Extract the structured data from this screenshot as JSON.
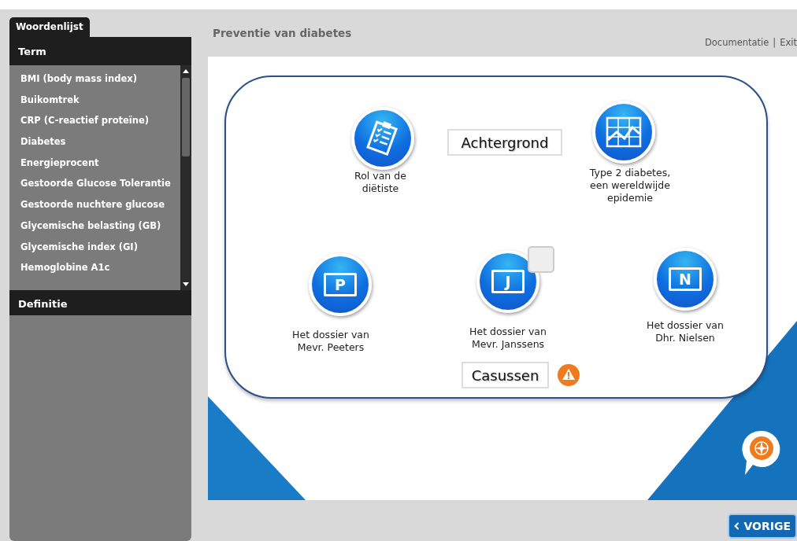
{
  "sidebar": {
    "tab": "Woordenlijst",
    "term_header": "Term",
    "terms": [
      {
        "label": "BMI (body mass index)",
        "selected": false
      },
      {
        "label": "Buikomtrek",
        "selected": false
      },
      {
        "label": "CRP (C-reactief proteïne)",
        "selected": false
      },
      {
        "label": "Diabetes",
        "selected": false
      },
      {
        "label": "Energieprocent",
        "selected": false
      },
      {
        "label": "Gestoorde Glucose Tolerantie",
        "selected": false
      },
      {
        "label": "Gestoorde nuchtere glucose",
        "selected": false
      },
      {
        "label": "Glycemische belasting (GB)",
        "selected": false
      },
      {
        "label": "Glycemische index (GI)",
        "selected": false
      },
      {
        "label": "Hemoglobine A1c",
        "selected": false
      }
    ],
    "definition_header": "Definitie"
  },
  "header": {
    "title": "Preventie van diabetes",
    "links": [
      "Documentatie",
      "Exit"
    ],
    "separator": "|"
  },
  "stage": {
    "sections": [
      {
        "label": "Achtergrond",
        "warning": false
      },
      {
        "label": "Casussen",
        "warning": true
      }
    ],
    "topics": [
      {
        "kind": "clipboard",
        "label": "Rol van de diëtiste"
      },
      {
        "kind": "chart",
        "label": "Type 2 diabetes, een wereldwijde epidemie"
      },
      {
        "kind": "folder",
        "letter": "P",
        "label": "Het dossier van Mevr. Peeters"
      },
      {
        "kind": "folder",
        "letter": "J",
        "label": "Het dossier van Mevr. Janssens",
        "checked": false
      },
      {
        "kind": "folder",
        "letter": "N",
        "label": "Het dossier van Dhr. Nielsen"
      }
    ]
  },
  "footer": {
    "back_button": "VORIGE"
  }
}
